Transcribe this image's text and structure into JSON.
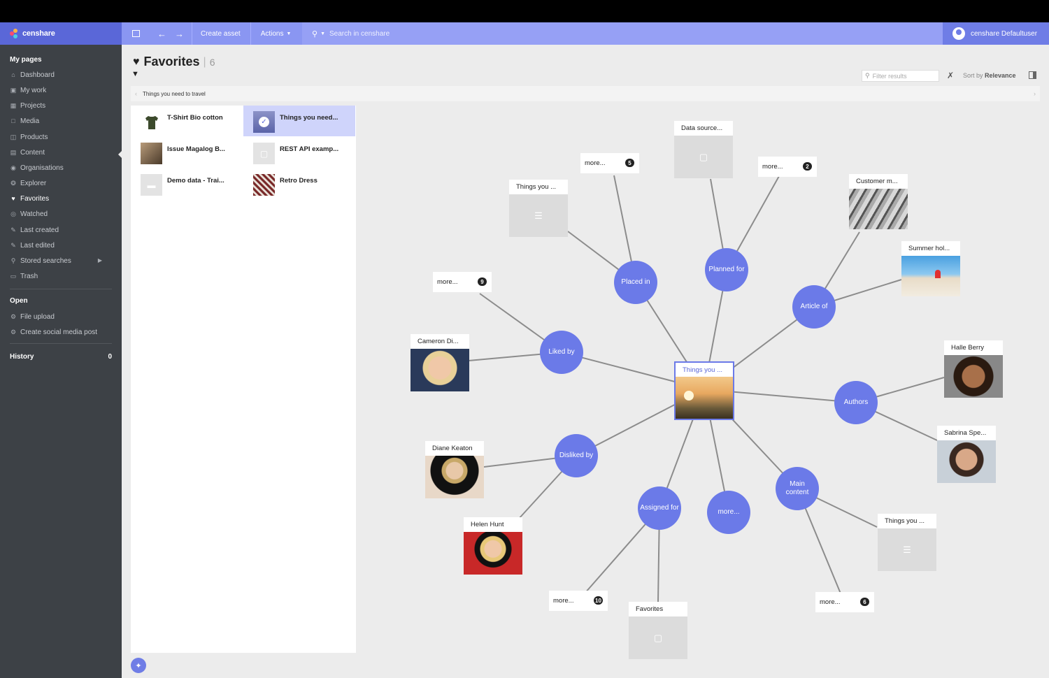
{
  "app": {
    "brand": "censhare",
    "colors": {
      "accent": "#6b7ae8",
      "header": "#8a96f2",
      "sidebar": "#3d4146",
      "brand": "#5a67d8"
    }
  },
  "header": {
    "sidebar_toggle_icon": "sidebar-toggle-icon",
    "create_asset": "Create asset",
    "actions": "Actions",
    "search_placeholder": "Search in censhare",
    "user": "censhare Defaultuser"
  },
  "sidebar": {
    "my_pages": "My pages",
    "items": [
      {
        "label": "Dashboard",
        "icon": "home-icon"
      },
      {
        "label": "My work",
        "icon": "briefcase-icon"
      },
      {
        "label": "Projects",
        "icon": "projects-icon"
      },
      {
        "label": "Media",
        "icon": "media-icon"
      },
      {
        "label": "Products",
        "icon": "products-icon"
      },
      {
        "label": "Content",
        "icon": "content-icon"
      },
      {
        "label": "Organisations",
        "icon": "organisations-icon"
      },
      {
        "label": "Explorer",
        "icon": "explorer-icon"
      },
      {
        "label": "Favorites",
        "icon": "heart-icon",
        "active": true
      },
      {
        "label": "Watched",
        "icon": "eye-icon"
      },
      {
        "label": "Last created",
        "icon": "last-created-icon"
      },
      {
        "label": "Last edited",
        "icon": "last-edited-icon"
      },
      {
        "label": "Stored searches",
        "icon": "search-icon"
      },
      {
        "label": "Trash",
        "icon": "trash-icon"
      }
    ],
    "open": "Open",
    "open_items": [
      {
        "label": "File upload",
        "icon": "gear-icon"
      },
      {
        "label": "Create social media post",
        "icon": "gear-icon"
      }
    ],
    "history": "History",
    "history_count": "0"
  },
  "main": {
    "title": "Favorites",
    "count": "6",
    "filter_placeholder": "Filter results",
    "sort_prefix": "Sort by",
    "sort_value": "Relevance",
    "breadcrumb": "Things you need to travel"
  },
  "list": {
    "items": [
      {
        "name": "T-Shirt Bio cotton"
      },
      {
        "name": "Things you need..."
      },
      {
        "name": "Issue Magalog B..."
      },
      {
        "name": "REST API examp..."
      },
      {
        "name": "Demo data - Trai..."
      },
      {
        "name": "Retro Dress"
      }
    ]
  },
  "graph": {
    "center": "Things you ...",
    "relations": {
      "placed_in": "Placed in",
      "planned_for": "Planned for",
      "article_of": "Article of",
      "liked_by": "Liked by",
      "authors": "Authors",
      "disliked_by": "Disliked by",
      "assigned_for": "Assigned for",
      "more": "more...",
      "main_content": "Main content"
    },
    "cards": {
      "data_source": "Data source...",
      "things_you_1": "Things you ...",
      "customer": "Customer m...",
      "summer": "Summer hol...",
      "cameron": "Cameron Di...",
      "halle": "Halle Berry",
      "sabrina": "Sabrina Spe...",
      "diane": "Diane Keaton",
      "helen": "Helen Hunt",
      "favorites": "Favorites",
      "things_you_2": "Things you ..."
    },
    "more": {
      "m1": {
        "label": "more...",
        "count": "5"
      },
      "m2": {
        "label": "more...",
        "count": "2"
      },
      "m3": {
        "label": "more...",
        "count": "9"
      },
      "m4": {
        "label": "more...",
        "count": "10"
      },
      "m5": {
        "label": "more...",
        "count": "6"
      }
    }
  }
}
